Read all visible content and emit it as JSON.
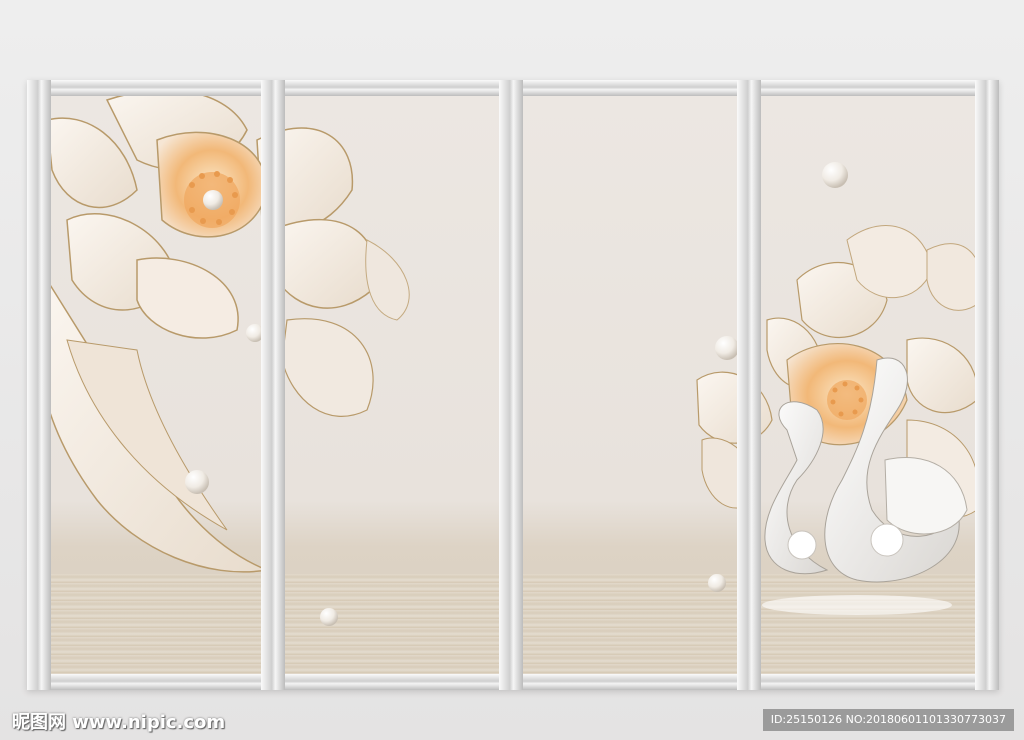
{
  "scene": {
    "panels": [
      {
        "name": "panel-1"
      },
      {
        "name": "panel-2"
      },
      {
        "name": "panel-3"
      },
      {
        "name": "panel-4"
      }
    ],
    "colors": {
      "background": "#ece7e2",
      "petal": "#f4ebe2",
      "petal_center": "#f2b878",
      "gold_edge": "#b89a6a",
      "rail": "#d0d0d0",
      "pearl": "#fbfaf8"
    },
    "icons": [
      "flower-icon",
      "swan-icon",
      "pearl-icon"
    ]
  },
  "watermark": {
    "site_text": "昵图网 www.nipic.com",
    "id_text": "ID:25150126 NO:20180601101330773037"
  }
}
